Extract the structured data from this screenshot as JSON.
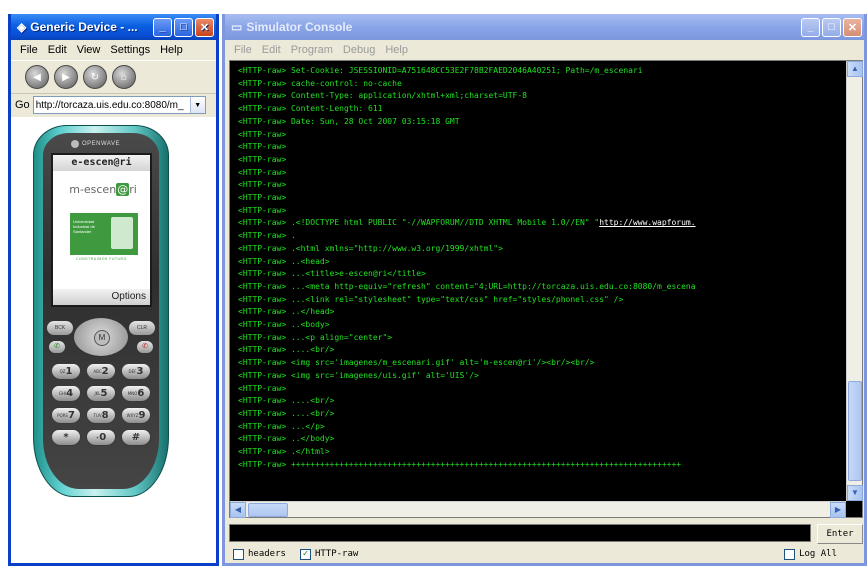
{
  "device_window": {
    "title": "Generic Device - ...",
    "menu": [
      "File",
      "Edit",
      "View",
      "Settings",
      "Help"
    ],
    "go_label": "Go",
    "url": "http://torcaza.uis.edu.co:8080/m_",
    "phone": {
      "brand": "OPENWAVE",
      "screen_title": "e-escen@ri",
      "logo_text": "m-escen",
      "logo_at": "@",
      "logo_tail": "ri",
      "uis_text": "Universidad Industrial de Santander",
      "uis_tagline": "CONSTRUIMOS FUTURO",
      "softkey_label": "Options",
      "left_soft": "BCK",
      "right_soft": "CLR",
      "keys": [
        {
          "num": "1",
          "sub": "QZ"
        },
        {
          "num": "2",
          "sub": "ABC"
        },
        {
          "num": "3",
          "sub": "DEF"
        },
        {
          "num": "4",
          "sub": "GHI"
        },
        {
          "num": "5",
          "sub": "JKL"
        },
        {
          "num": "6",
          "sub": "MNO"
        },
        {
          "num": "7",
          "sub": "PQRS"
        },
        {
          "num": "8",
          "sub": "TUV"
        },
        {
          "num": "9",
          "sub": "WXYZ"
        },
        {
          "num": "*",
          "sub": ""
        },
        {
          "num": "0",
          "sub": "+"
        },
        {
          "num": "#",
          "sub": ""
        }
      ]
    }
  },
  "console_window": {
    "title": "Simulator Console",
    "menu": [
      "File",
      "Edit",
      "Program",
      "Debug",
      "Help"
    ],
    "lines": [
      "<HTTP-raw> Set-Cookie: JSESSIONID=A751648CC53E2F78B2FAED2046A40251; Path=/m_escenari",
      "<HTTP-raw> cache-control: no-cache",
      "<HTTP-raw> Content-Type: application/xhtml+xml;charset=UTF-8",
      "<HTTP-raw> Content-Length: 611",
      "<HTTP-raw> Date: Sun, 28 Oct 2007 03:15:18 GMT",
      "<HTTP-raw>",
      "<HTTP-raw>",
      "<HTTP-raw>",
      "<HTTP-raw>",
      "<HTTP-raw>",
      "<HTTP-raw>",
      "<HTTP-raw>",
      "<HTTP-raw> .<!DOCTYPE html PUBLIC \"-//WAPFORUM//DTD XHTML Mobile 1.0//EN\" \"",
      "<HTTP-raw> .",
      "<HTTP-raw> .<html xmlns=\"http://www.w3.org/1999/xhtml\">",
      "<HTTP-raw> ..<head>",
      "<HTTP-raw> ...<title>e-escen@ri</title>",
      "<HTTP-raw> ...<meta http-equiv=\"refresh\" content=\"4;URL=http://torcaza.uis.edu.co:8080/m_escena",
      "<HTTP-raw> ...<link rel=\"stylesheet\" type=\"text/css\" href=\"styles/phonel.css\" />",
      "<HTTP-raw> ..</head>",
      "<HTTP-raw> ..<body>",
      "<HTTP-raw> ...<p align=\"center\">",
      "<HTTP-raw> ....<br/>",
      "<HTTP-raw> <img src='imagenes/m_escenari.gif' alt='m-escen@ri'/><br/><br/>",
      "<HTTP-raw> <img src='imagenes/uis.gif' alt='UIS'/>",
      "<HTTP-raw>",
      "<HTTP-raw> ....<br/>",
      "<HTTP-raw> ....<br/>",
      "<HTTP-raw> ...</p>",
      "<HTTP-raw> ..</body>",
      "<HTTP-raw> .</html>",
      "<HTTP-raw> +++++++++++++++++++++++++++++++++++++++++++++++++++++++++++++++++++++++++++++++++"
    ],
    "doctype_link": "http://www.wapforum.",
    "enter_label": "Enter",
    "checkboxes": [
      {
        "label": "headers",
        "checked": false
      },
      {
        "label": "HTTP-raw",
        "checked": true
      }
    ],
    "log_all": {
      "label": "Log All",
      "checked": false
    }
  }
}
